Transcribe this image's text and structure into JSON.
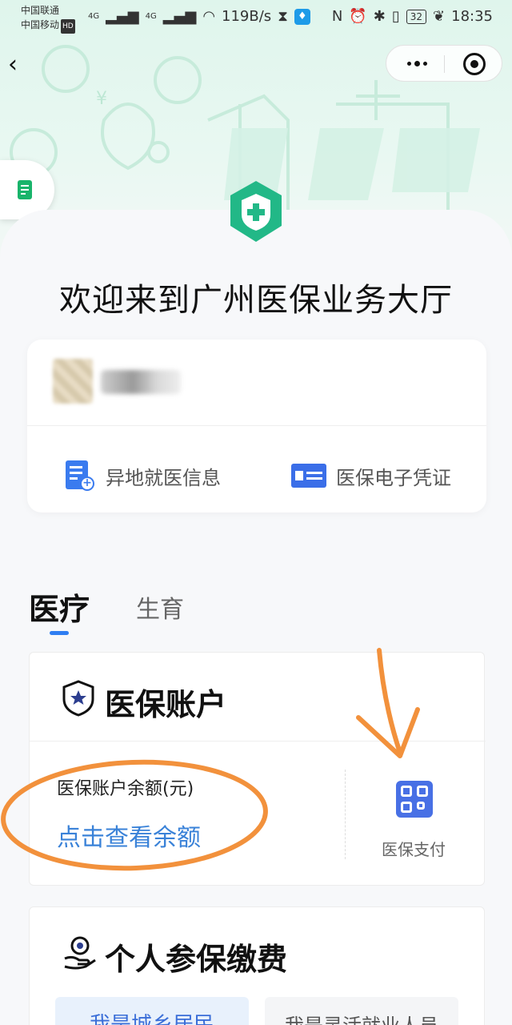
{
  "status_bar": {
    "carrier1": "中国联通",
    "carrier2": "中国移动",
    "hd": "HD",
    "net1": "4G",
    "net2": "4G",
    "speed": "119B/s",
    "battery": "32",
    "time": "18:35"
  },
  "nav": {
    "back_icon": "chevron-left-icon",
    "more_icon": "more-dots-icon",
    "close_icon": "target-close-icon"
  },
  "floating_tab": {
    "icon": "document-icon"
  },
  "welcome_title": "欢迎来到广州医保业务大厅",
  "user_card": {
    "name": "",
    "links": [
      {
        "label": "异地就医信息",
        "icon": "document-plus-icon"
      },
      {
        "label": "医保电子凭证",
        "icon": "id-card-icon"
      }
    ]
  },
  "tabs": [
    {
      "label": "医疗",
      "active": true
    },
    {
      "label": "生育",
      "active": false
    }
  ],
  "account_card": {
    "title": "医保账户",
    "balance_label": "医保账户余额(元)",
    "balance_link": "点击查看余额",
    "pay_label": "医保支付",
    "pay_icon": "qr-code-icon"
  },
  "payment_card": {
    "title": "个人参保缴费",
    "options": [
      "我是城乡居民",
      "我是灵活就业人员"
    ]
  },
  "colors": {
    "brand_green": "#19b46b",
    "link_blue": "#3a82d8",
    "annotation_orange": "#f2913c"
  }
}
